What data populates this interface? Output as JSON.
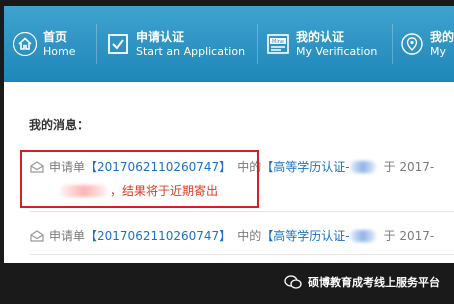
{
  "nav": {
    "items": [
      {
        "zh": "首页",
        "en": "Home",
        "icon": "home-icon"
      },
      {
        "zh": "申请认证",
        "en": "Start an Application",
        "icon": "checkbox-icon"
      },
      {
        "zh": "我的认证",
        "en": "My Verification",
        "icon": "mine-card-icon"
      },
      {
        "zh": "我的",
        "en": "My",
        "icon": "location-pin-icon"
      }
    ],
    "bg_color": "#2a93c6"
  },
  "messages": {
    "title": "我的消息：",
    "items": [
      {
        "prefix": "申请单",
        "app_no": "【2017062110260747】",
        "mid": "中的",
        "type": "【高等学历认证-",
        "suffix": "于 2017-",
        "line2": "，结果将于近期寄出"
      },
      {
        "prefix": "申请单",
        "app_no": "【2017062110260747】",
        "mid": "中的",
        "type": "【高等学历认证-",
        "suffix": "于 2017-"
      }
    ]
  },
  "watermark": {
    "text": "硕博教育成考线上服务平台"
  },
  "colors": {
    "accent": "#1a72c8",
    "highlight": "#d81e1e",
    "notice": "#e03a1f"
  }
}
